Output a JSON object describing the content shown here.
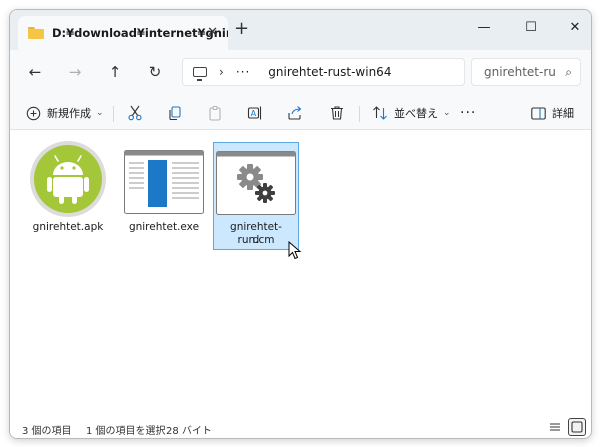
{
  "window": {
    "tab_title": "D:¥download¥internet¥gnireh",
    "tab_close": "✕",
    "new_tab": "+",
    "minimize": "—",
    "maximize": "☐",
    "close": "✕"
  },
  "nav": {
    "back": "←",
    "forward": "→",
    "up": "↑",
    "refresh": "↻",
    "breadcrumb_chevron": "›",
    "breadcrumb_overflow": "···",
    "current_folder": "gnirehtet-rust-win64",
    "search_placeholder": "gnirehtet-ru",
    "search_icon": "⌕"
  },
  "command_bar": {
    "new_label": "新規作成",
    "new_chevron": "⌄",
    "sort_label": "並べ替え",
    "sort_chevron": "⌄",
    "more": "···",
    "details_label": "詳細",
    "icons": [
      "cut-icon",
      "copy-icon",
      "paste-icon",
      "rename-icon",
      "share-icon",
      "delete-icon",
      "sort-icon",
      "details-pane-icon"
    ]
  },
  "files": [
    {
      "name": "gnirehtet.apk",
      "icon": "android-icon",
      "selected": false
    },
    {
      "name": "gnirehtet.exe",
      "icon": "exe-window-icon",
      "selected": false
    },
    {
      "name_line1": "gnirehtet-run.cm",
      "name_line2": "d",
      "icon": "gears-icon",
      "selected": true
    }
  ],
  "status": {
    "item_count": "3 個の項目",
    "selection": "1 個の項目を選択",
    "size": "28 バイト"
  },
  "colors": {
    "selection_fill": "#cce8ff",
    "selection_border": "#5ea6dd",
    "android_green": "#a4c639",
    "exe_blue": "#1e78c8"
  }
}
